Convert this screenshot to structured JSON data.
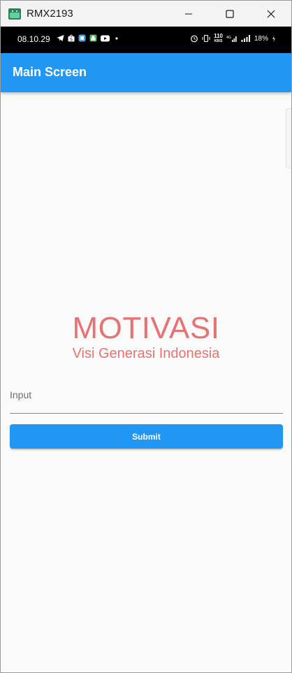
{
  "window": {
    "title": "RMX2193",
    "controls": [
      "minimize",
      "maximize",
      "close"
    ]
  },
  "statusbar": {
    "time": "08.10.29",
    "net_speed_value": "110",
    "net_speed_unit": "KB/S",
    "battery": "18%",
    "left_icons": [
      "telegram-icon",
      "shopee-icon",
      "files-icon",
      "android-green-icon",
      "youtube-icon",
      "dot-icon"
    ],
    "right_icons": [
      "alarm-icon",
      "vibrate-icon",
      "wifi-4g-icon",
      "signal-icon",
      "battery-icon"
    ]
  },
  "appbar": {
    "title": "Main Screen"
  },
  "content": {
    "headline": "MOTIVASI",
    "subheadline": "Visi Generasi Indonesia",
    "input_placeholder": "Input",
    "input_value": "",
    "submit_label": "Submit"
  },
  "colors": {
    "primary": "#2196f3",
    "accent_text": "#e57373",
    "background": "#fafafa"
  }
}
